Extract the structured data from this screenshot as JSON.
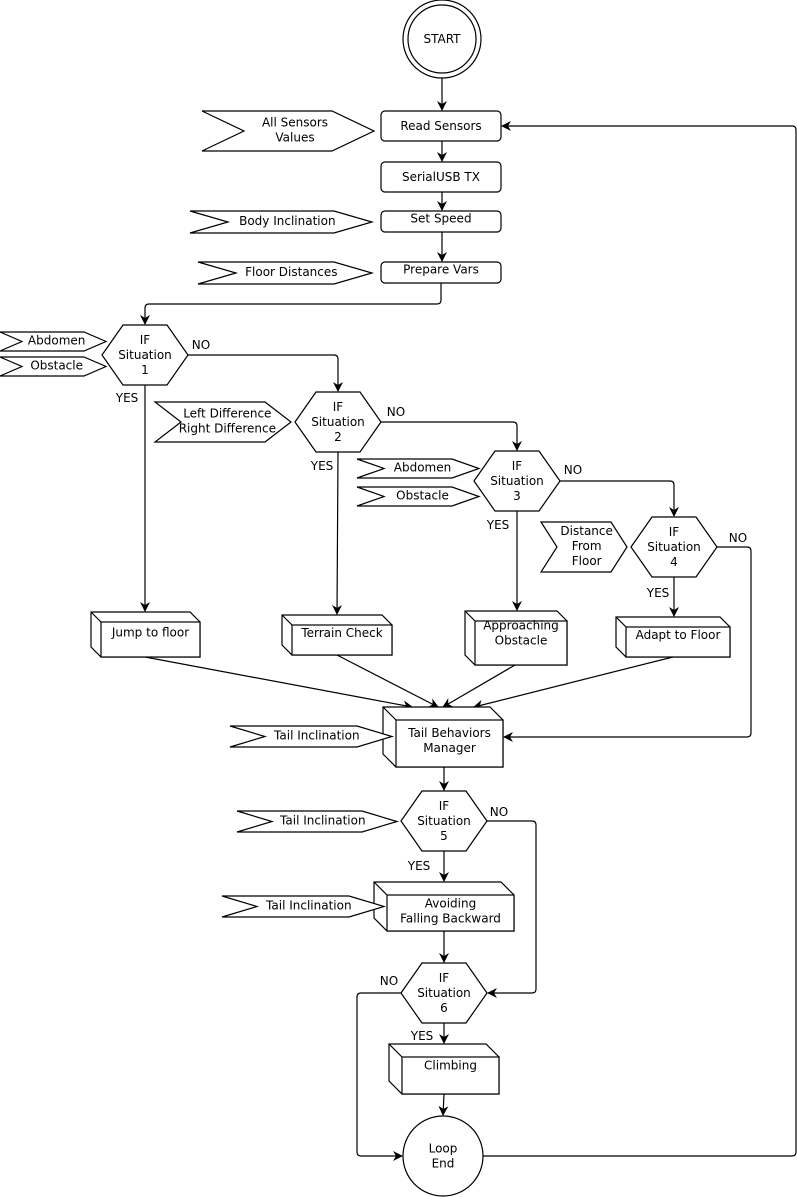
{
  "diagram": {
    "type": "flowchart",
    "colors": {
      "stroke": "#000000",
      "fill": "#ffffff",
      "text": "#000000"
    },
    "nodes": {
      "start": {
        "kind": "double-circle",
        "lines": [
          "START"
        ]
      },
      "read_sensors": {
        "kind": "process",
        "lines": [
          "Read Sensors"
        ]
      },
      "serial_tx": {
        "kind": "process",
        "lines": [
          "SerialUSB TX"
        ]
      },
      "set_speed": {
        "kind": "process",
        "lines": [
          "Set Speed"
        ]
      },
      "prepare_vars": {
        "kind": "process",
        "lines": [
          "Prepare Vars"
        ]
      },
      "if1": {
        "kind": "decision",
        "lines": [
          "IF",
          "Situation",
          "1"
        ]
      },
      "if2": {
        "kind": "decision",
        "lines": [
          "IF",
          "Situation",
          "2"
        ]
      },
      "if3": {
        "kind": "decision",
        "lines": [
          "IF",
          "Situation",
          "3"
        ]
      },
      "if4": {
        "kind": "decision",
        "lines": [
          "IF",
          "Situation",
          "4"
        ]
      },
      "jump": {
        "kind": "box3d",
        "lines": [
          "Jump to floor"
        ]
      },
      "terrain": {
        "kind": "box3d",
        "lines": [
          "Terrain Check"
        ]
      },
      "approach": {
        "kind": "box3d",
        "lines": [
          "Approaching",
          "Obstacle"
        ]
      },
      "adapt": {
        "kind": "box3d",
        "lines": [
          "Adapt to Floor"
        ]
      },
      "tail_mgr": {
        "kind": "box3d",
        "lines": [
          "Tail Behaviors",
          "Manager"
        ]
      },
      "if5": {
        "kind": "decision",
        "lines": [
          "IF",
          "Situation",
          "5"
        ]
      },
      "avoid": {
        "kind": "box3d",
        "lines": [
          "Avoiding",
          "Falling Backward"
        ]
      },
      "if6": {
        "kind": "decision",
        "lines": [
          "IF",
          "Situation",
          "6"
        ]
      },
      "climb": {
        "kind": "box3d",
        "lines": [
          "Climbing"
        ]
      },
      "loop_end": {
        "kind": "circle",
        "lines": [
          "Loop",
          "End"
        ]
      }
    },
    "signals": {
      "all_sensors": {
        "lines": [
          "All Sensors",
          "Values"
        ],
        "target": "read_sensors"
      },
      "body_incl": {
        "lines": [
          "Body Inclination"
        ],
        "target": "set_speed"
      },
      "floor_dist": {
        "lines": [
          "Floor Distances"
        ],
        "target": "prepare_vars"
      },
      "abdomen1": {
        "lines": [
          "Abdomen"
        ],
        "target": "if1"
      },
      "obstacle1": {
        "lines": [
          "Obstacle"
        ],
        "target": "if1"
      },
      "diff": {
        "lines": [
          "Left Difference",
          "Right Difference"
        ],
        "target": "if2"
      },
      "abdomen3": {
        "lines": [
          "Abdomen"
        ],
        "target": "if3"
      },
      "obstacle3": {
        "lines": [
          "Obstacle"
        ],
        "target": "if3"
      },
      "dist_floor": {
        "lines": [
          "Distance",
          "From",
          "Floor"
        ],
        "target": "if4"
      },
      "tail_incl_mgr": {
        "lines": [
          "Tail Inclination"
        ],
        "target": "tail_mgr"
      },
      "tail_incl_if5": {
        "lines": [
          "Tail Inclination"
        ],
        "target": "if5"
      },
      "tail_incl_avoid": {
        "lines": [
          "Tail Inclination"
        ],
        "target": "avoid"
      }
    },
    "edge_labels": {
      "if1_no": "NO",
      "if1_yes": "YES",
      "if2_no": "NO",
      "if2_yes": "YES",
      "if3_no": "NO",
      "if3_yes": "YES",
      "if4_no": "NO",
      "if4_yes": "YES",
      "if5_no": "NO",
      "if5_yes": "YES",
      "if6_no": "NO",
      "if6_yes": "YES"
    },
    "edges": [
      [
        "start",
        "read_sensors"
      ],
      [
        "read_sensors",
        "serial_tx"
      ],
      [
        "serial_tx",
        "set_speed"
      ],
      [
        "set_speed",
        "prepare_vars"
      ],
      [
        "prepare_vars",
        "if1"
      ],
      [
        "if1",
        "if2",
        "NO"
      ],
      [
        "if1",
        "jump",
        "YES"
      ],
      [
        "if2",
        "if3",
        "NO"
      ],
      [
        "if2",
        "terrain",
        "YES"
      ],
      [
        "if3",
        "if4",
        "NO"
      ],
      [
        "if3",
        "approach",
        "YES"
      ],
      [
        "if4",
        "tail_mgr",
        "NO"
      ],
      [
        "if4",
        "adapt",
        "YES"
      ],
      [
        "jump",
        "tail_mgr"
      ],
      [
        "terrain",
        "tail_mgr"
      ],
      [
        "approach",
        "tail_mgr"
      ],
      [
        "adapt",
        "tail_mgr"
      ],
      [
        "tail_mgr",
        "if5"
      ],
      [
        "if5",
        "avoid",
        "YES"
      ],
      [
        "if5",
        "if6",
        "NO"
      ],
      [
        "avoid",
        "if6"
      ],
      [
        "if6",
        "climb",
        "YES"
      ],
      [
        "if6",
        "loop_end",
        "NO"
      ],
      [
        "climb",
        "loop_end"
      ],
      [
        "loop_end",
        "read_sensors"
      ]
    ]
  }
}
